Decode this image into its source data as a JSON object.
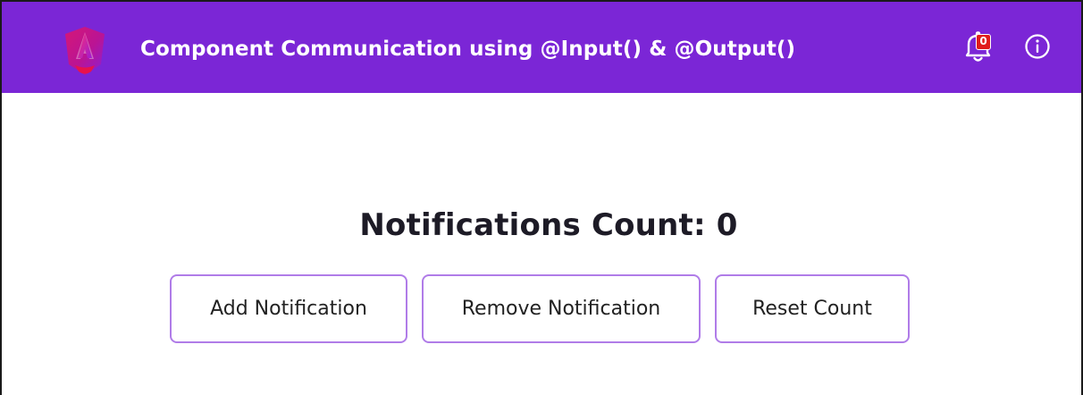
{
  "header": {
    "title": "Component Communication using @Input() & @Output()",
    "background_color": "#7b26d6",
    "logo_icon": "angular-logo-icon",
    "notification_icon": "bell-icon",
    "notification_badge": "0",
    "info_icon": "info-icon"
  },
  "main": {
    "count_heading": "Notifications Count: 0",
    "buttons": {
      "add_label": "Add Notification",
      "remove_label": "Remove Notification",
      "reset_label": "Reset Count"
    },
    "button_border_color": "#b07ce8"
  }
}
